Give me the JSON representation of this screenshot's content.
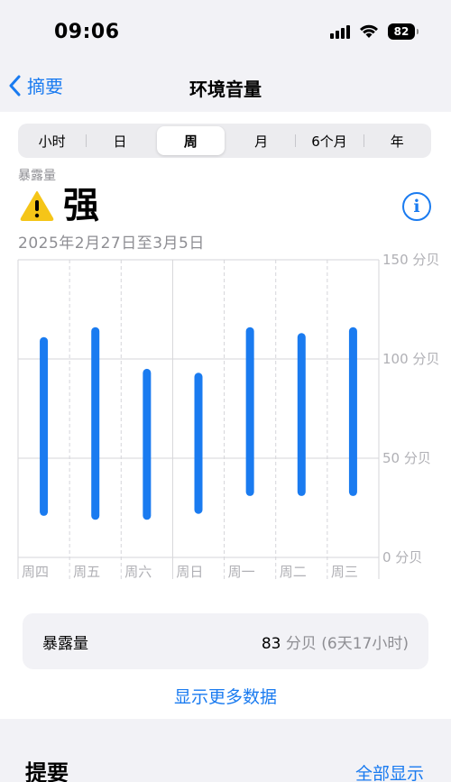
{
  "status": {
    "time": "09:06",
    "battery": "82",
    "icons": [
      "cellular-signal-icon",
      "wifi-icon",
      "battery-icon"
    ]
  },
  "nav": {
    "back_label": "摘要",
    "title": "环境音量",
    "back_icon": "chevron-left-icon"
  },
  "segments": [
    {
      "label": "小时",
      "active": false
    },
    {
      "label": "日",
      "active": false
    },
    {
      "label": "周",
      "active": true
    },
    {
      "label": "月",
      "active": false
    },
    {
      "label": "6个月",
      "active": false
    },
    {
      "label": "年",
      "active": false
    }
  ],
  "metric": {
    "label": "暴露量",
    "level": "强",
    "warning_icon": "warning-triangle-icon",
    "info_icon": "info-circle-icon",
    "date_range": "2025年2月27日至3月5日"
  },
  "colors": {
    "accent": "#1a7bf0",
    "bar": "#1a7bf0",
    "warning": "#f5c518",
    "grid": "#d6d6da",
    "muted": "#8e8e93"
  },
  "chart_data": {
    "type": "range-bar",
    "categories": [
      "周四",
      "周五",
      "周六",
      "周日",
      "周一",
      "周二",
      "周三"
    ],
    "series": [
      {
        "low": [
          23,
          21,
          21,
          24,
          33,
          33,
          33
        ],
        "high": [
          109,
          114,
          93,
          91,
          114,
          111,
          114
        ]
      }
    ],
    "ylim": [
      0,
      150
    ],
    "yticks": [
      {
        "value": 150,
        "label": "150 分贝"
      },
      {
        "value": 100,
        "label": "100 分贝"
      },
      {
        "value": 50,
        "label": "50 分贝"
      },
      {
        "value": 0,
        "label": "0 分贝"
      }
    ],
    "grid": true
  },
  "summary": {
    "label": "暴露量",
    "value": "83",
    "unit_detail": "分贝 (6天17小时)"
  },
  "more_link": "显示更多数据",
  "bottom": {
    "title": "提要",
    "show_all": "全部显示"
  }
}
